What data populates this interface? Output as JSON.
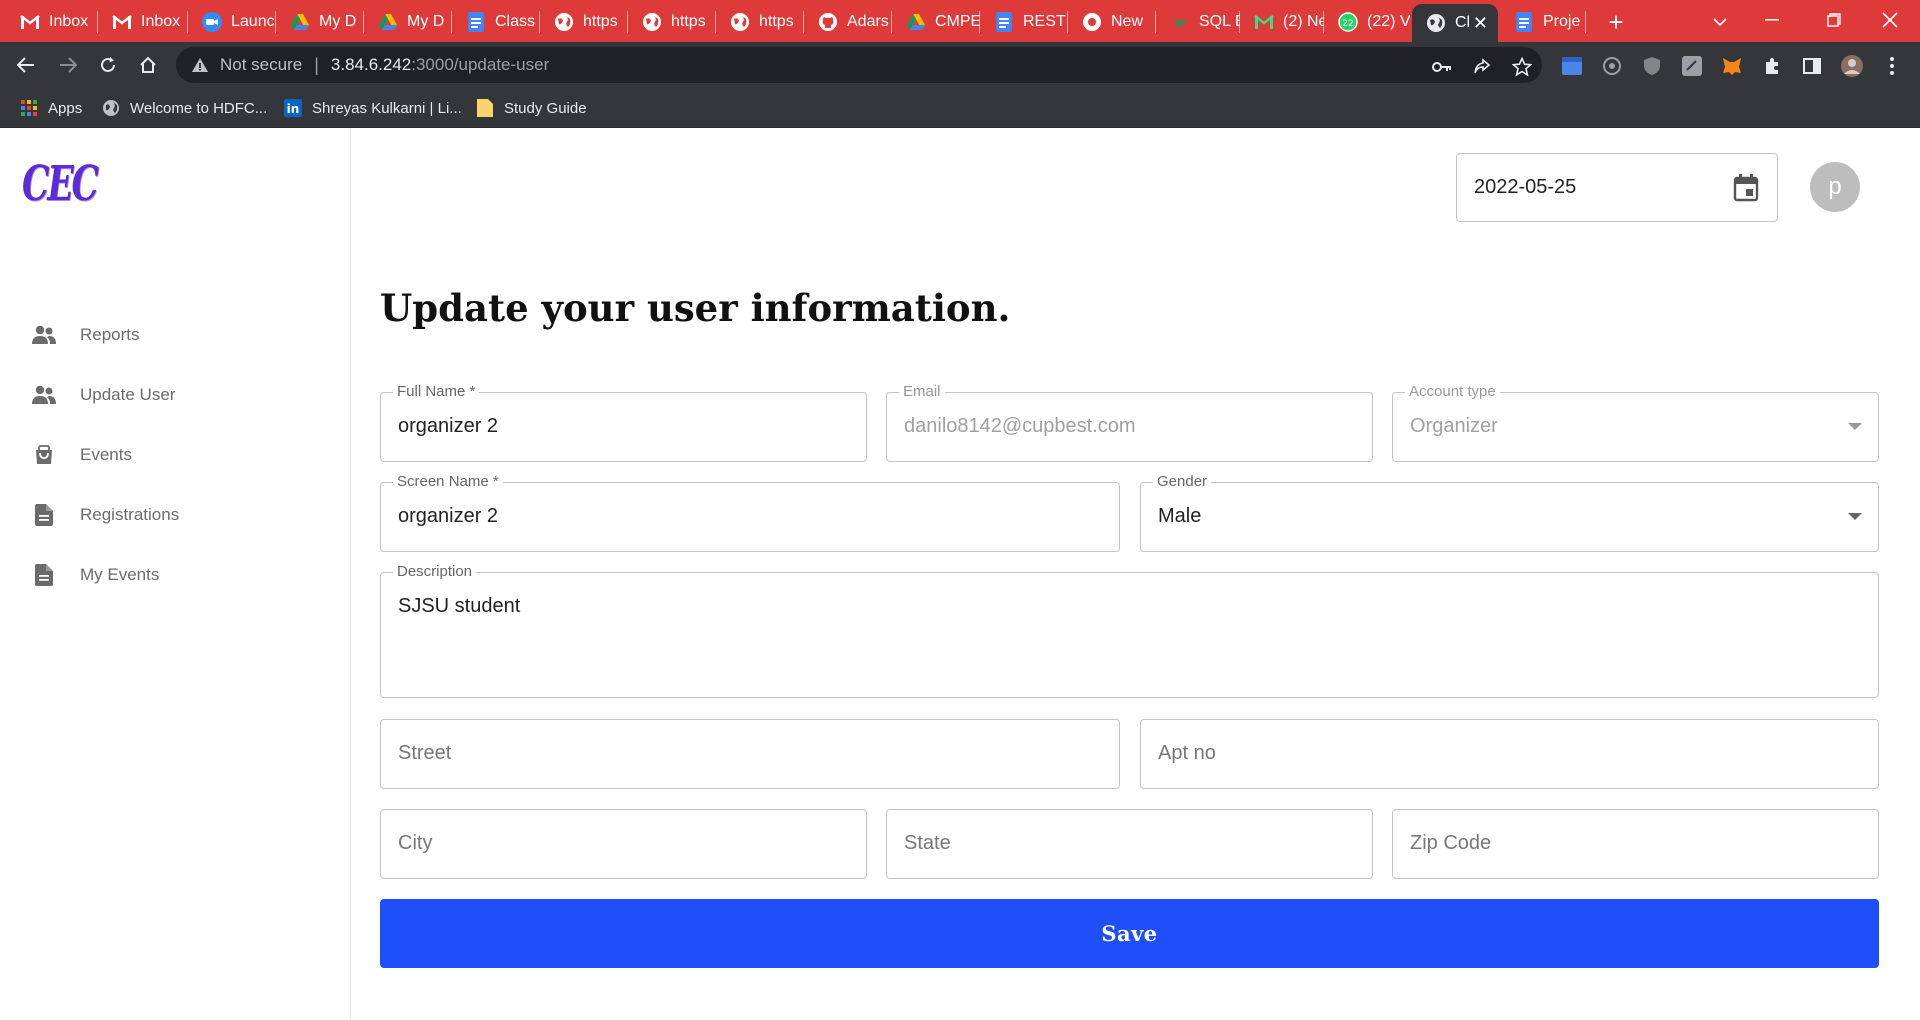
{
  "browser": {
    "tabs": [
      {
        "title": "Inbox",
        "icon": "gmail-icon"
      },
      {
        "title": "Inbox",
        "icon": "gmail-icon"
      },
      {
        "title": "Launc",
        "icon": "zoom-icon"
      },
      {
        "title": "My D",
        "icon": "drive-icon"
      },
      {
        "title": "My D",
        "icon": "drive-icon"
      },
      {
        "title": "Class",
        "icon": "docs-icon"
      },
      {
        "title": "https",
        "icon": "globe-icon"
      },
      {
        "title": "https",
        "icon": "globe-icon"
      },
      {
        "title": "https",
        "icon": "globe-icon"
      },
      {
        "title": "Adars",
        "icon": "github-icon"
      },
      {
        "title": "CMPE",
        "icon": "drive-icon"
      },
      {
        "title": "REST",
        "icon": "docs-icon"
      },
      {
        "title": "New",
        "icon": "chrome-icon"
      },
      {
        "title": "SQL E",
        "icon": "w3-icon"
      },
      {
        "title": "(2) Ne",
        "icon": "gmail-green-icon"
      },
      {
        "title": "(22) V",
        "icon": "whatsapp-icon"
      },
      {
        "title": "Cl",
        "icon": "globe-icon",
        "active": true
      },
      {
        "title": "Proje",
        "icon": "docs-icon"
      }
    ],
    "address": {
      "security": "Not secure",
      "host": "3.84.6.242",
      "path": ":3000/update-user"
    },
    "bookmarks": [
      {
        "label": "Apps",
        "icon": "apps-grid-icon"
      },
      {
        "label": "Welcome to HDFC...",
        "icon": "globe-icon"
      },
      {
        "label": "Shreyas Kulkarni | Li...",
        "icon": "linkedin-icon"
      },
      {
        "label": "Study Guide",
        "icon": "folder-icon"
      }
    ]
  },
  "app": {
    "logo_text": "CEC",
    "sidebar": [
      {
        "label": "Reports",
        "icon": "people-icon"
      },
      {
        "label": "Update User",
        "icon": "people-icon"
      },
      {
        "label": "Events",
        "icon": "shopping-bag-icon"
      },
      {
        "label": "Registrations",
        "icon": "document-icon"
      },
      {
        "label": "My Events",
        "icon": "document-icon"
      }
    ],
    "date": "2022-05-25",
    "avatar_letter": "p",
    "heading": "Update your user information.",
    "form": {
      "full_name": {
        "label": "Full Name *",
        "value": "organizer 2"
      },
      "email": {
        "label": "Email",
        "value": "danilo8142@cupbest.com"
      },
      "account_type": {
        "label": "Account type",
        "value": "Organizer"
      },
      "screen_name": {
        "label": "Screen Name *",
        "value": "organizer 2"
      },
      "gender": {
        "label": "Gender",
        "value": "Male"
      },
      "description": {
        "label": "Description",
        "value": "SJSU student"
      },
      "street": {
        "placeholder": "Street"
      },
      "apt_no": {
        "placeholder": "Apt no"
      },
      "city": {
        "placeholder": "City"
      },
      "state": {
        "placeholder": "State"
      },
      "zip": {
        "placeholder": "Zip Code"
      },
      "save_label": "Save"
    },
    "colors": {
      "primary": "#1e4ff9",
      "tabstrip": "#de3a3a",
      "logo": "#5b2bd6"
    }
  }
}
